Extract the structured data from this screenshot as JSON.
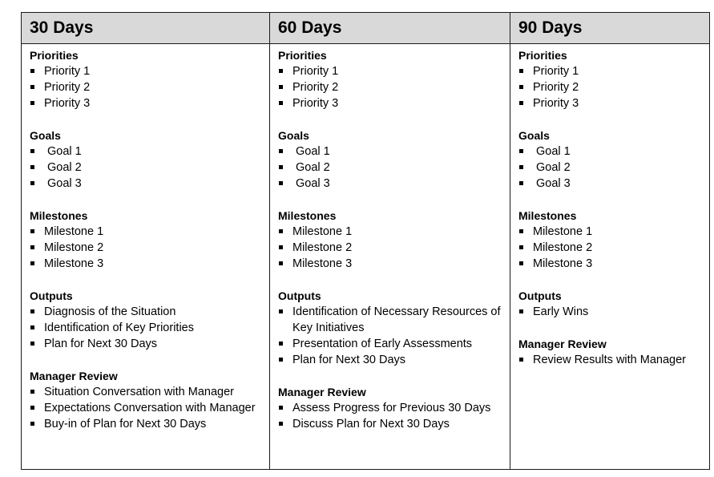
{
  "columns": [
    {
      "header": "30 Days",
      "sections": [
        {
          "title": "Priorities",
          "items": [
            "Priority 1",
            "Priority 2",
            "Priority 3"
          ]
        },
        {
          "title": "Goals",
          "items": [
            "Goal 1",
            "Goal 2",
            "Goal 3"
          ]
        },
        {
          "title": "Milestones",
          "items": [
            "Milestone 1",
            "Milestone 2",
            "Milestone 3"
          ]
        },
        {
          "title": "Outputs",
          "items": [
            "Diagnosis of the Situation",
            "Identification of Key Priorities",
            "Plan for Next 30 Days"
          ]
        },
        {
          "title": "Manager Review",
          "items": [
            "Situation Conversation with Manager",
            "Expectations Conversation with Manager",
            "Buy-in of Plan for Next 30 Days"
          ]
        }
      ]
    },
    {
      "header": "60 Days",
      "sections": [
        {
          "title": "Priorities",
          "items": [
            "Priority 1",
            "Priority 2",
            "Priority 3"
          ]
        },
        {
          "title": "Goals",
          "items": [
            "Goal 1",
            "Goal 2",
            "Goal 3"
          ]
        },
        {
          "title": "Milestones",
          "items": [
            "Milestone 1",
            "Milestone 2",
            "Milestone 3"
          ]
        },
        {
          "title": "Outputs",
          "items": [
            "Identification of Necessary Resources of Key Initiatives",
            "Presentation of Early Assessments",
            "Plan for Next 30 Days"
          ]
        },
        {
          "title": "Manager Review",
          "items": [
            "Assess Progress for Previous 30 Days",
            "Discuss Plan for Next 30 Days"
          ]
        }
      ]
    },
    {
      "header": "90 Days",
      "sections": [
        {
          "title": "Priorities",
          "items": [
            "Priority 1",
            "Priority 2",
            "Priority 3"
          ]
        },
        {
          "title": "Goals",
          "items": [
            "Goal 1",
            "Goal 2",
            "Goal 3"
          ]
        },
        {
          "title": "Milestones",
          "items": [
            "Milestone 1",
            "Milestone 2",
            "Milestone 3"
          ]
        },
        {
          "title": "Outputs",
          "items": [
            "Early Wins"
          ]
        },
        {
          "title": "Manager Review",
          "items": [
            "Review Results with Manager"
          ]
        }
      ]
    }
  ]
}
